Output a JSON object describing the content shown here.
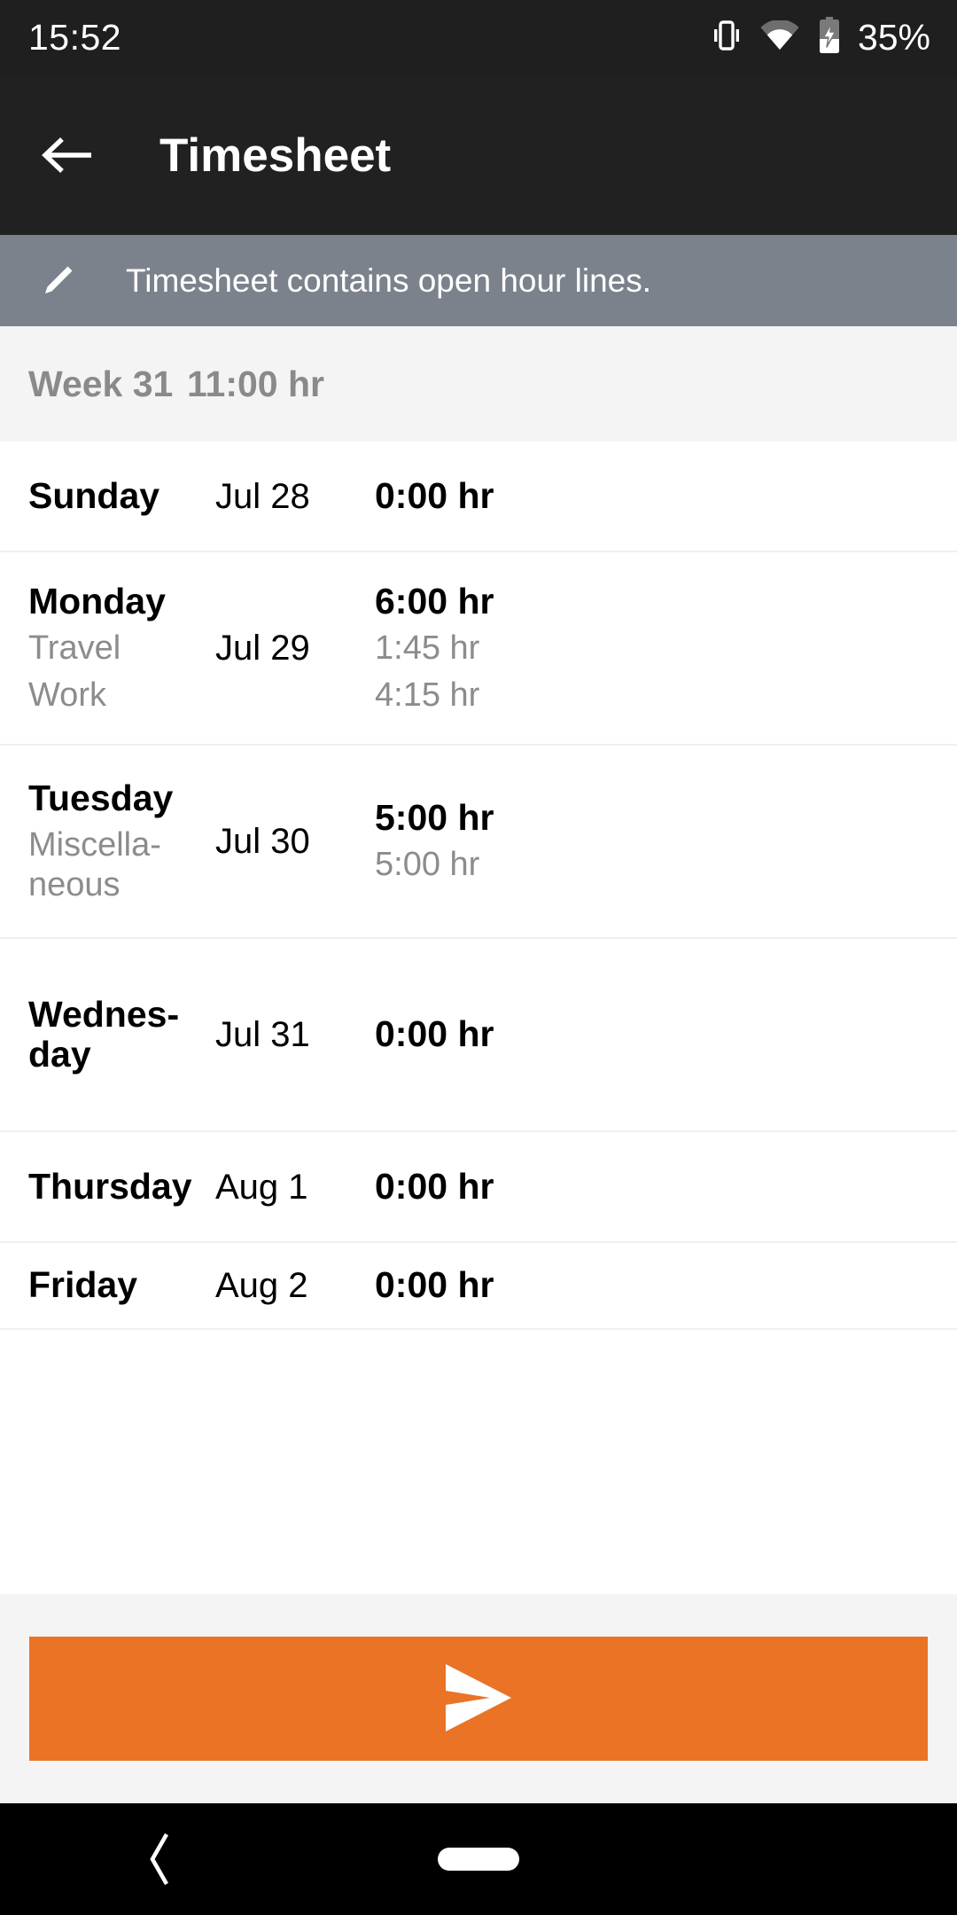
{
  "status_bar": {
    "clock": "15:52",
    "battery_percent": "35%",
    "icons": [
      "vibrate-icon",
      "wifi-icon",
      "battery-charging-icon"
    ]
  },
  "app_bar": {
    "title": "Timesheet",
    "back_icon": "arrow-back-icon"
  },
  "notice": {
    "icon": "pencil-icon",
    "text": "Timesheet contains open hour lines."
  },
  "week_header": {
    "label": "Week 31",
    "total": "11:00 hr"
  },
  "days": [
    {
      "name": "Sunday",
      "date": "Jul 28",
      "total": "0:00 hr",
      "lines": []
    },
    {
      "name": "Monday",
      "date": "Jul 29",
      "total": "6:00 hr",
      "lines": [
        {
          "label": "Travel",
          "hours": "1:45 hr"
        },
        {
          "label": "Work",
          "hours": "4:15 hr"
        }
      ]
    },
    {
      "name": "Tuesday",
      "date": "Jul 30",
      "total": "5:00 hr",
      "lines": [
        {
          "label": "Miscella-\nneous",
          "hours": "5:00 hr"
        }
      ]
    },
    {
      "name": "Wednes-\nday",
      "date": "Jul 31",
      "total": "0:00 hr",
      "lines": []
    },
    {
      "name": "Thursday",
      "date": "Aug 1",
      "total": "0:00 hr",
      "lines": []
    },
    {
      "name": "Friday",
      "date": "Aug 2",
      "total": "0:00 hr",
      "lines": []
    }
  ],
  "submit": {
    "icon": "send-icon",
    "color": "#ea7325"
  },
  "nav_bar": {
    "back_icon": "nav-back-icon",
    "home_icon": "nav-home-pill"
  },
  "colors": {
    "status_bar_bg": "#1f1f1f",
    "app_bar_bg": "#212121",
    "notice_bg": "#7c828c",
    "week_header_bg": "#f4f4f4",
    "accent": "#ea7325",
    "muted_text": "#8c8c8c"
  }
}
